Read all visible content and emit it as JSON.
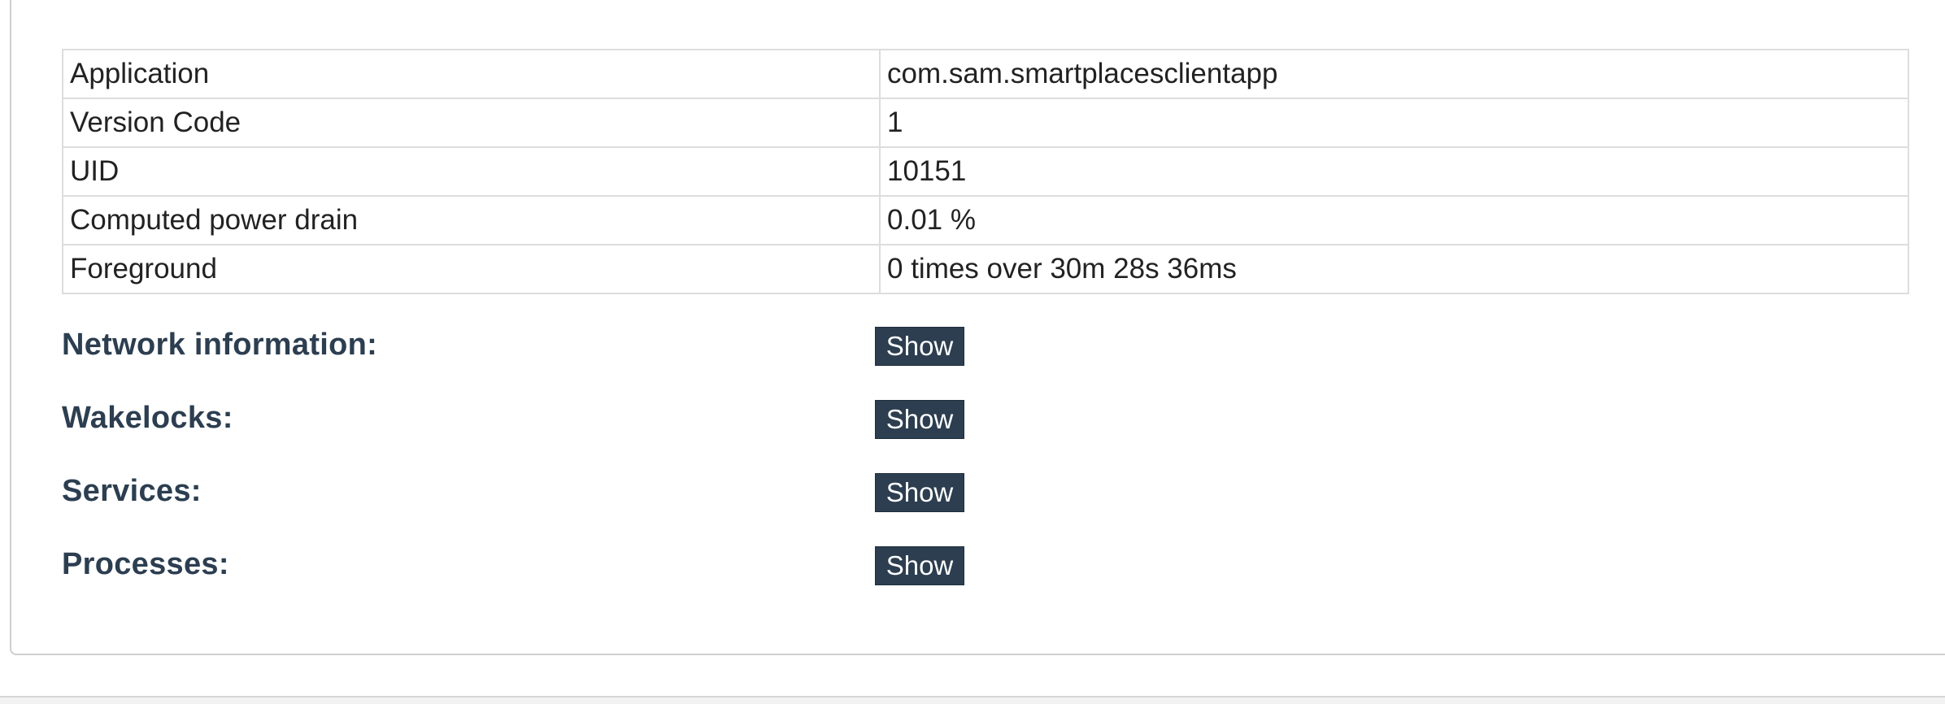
{
  "app_info": {
    "rows": [
      {
        "key": "Application",
        "value": "com.sam.smartplacesclientapp"
      },
      {
        "key": "Version Code",
        "value": "1"
      },
      {
        "key": "UID",
        "value": "10151"
      },
      {
        "key": "Computed power drain",
        "value": "0.01 %"
      },
      {
        "key": "Foreground",
        "value": "0 times over 30m 28s 36ms"
      }
    ]
  },
  "sections": {
    "network": {
      "title": "Network information:",
      "button": "Show"
    },
    "wakelocks": {
      "title": "Wakelocks:",
      "button": "Show"
    },
    "services": {
      "title": "Services:",
      "button": "Show"
    },
    "processes": {
      "title": "Processes:",
      "button": "Show"
    }
  },
  "colors": {
    "accent": "#2c3e50",
    "border": "#dddddd"
  }
}
